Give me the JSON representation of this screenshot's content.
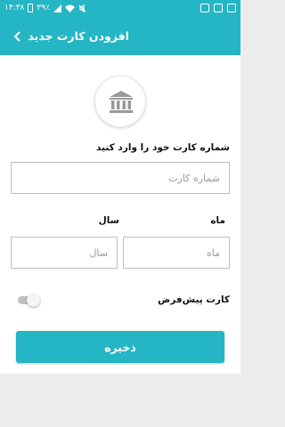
{
  "status_bar": {
    "time": "۱۴:۳۸",
    "battery": "۳۹٪",
    "icons": [
      "wifi-icon",
      "signal-icon",
      "mute-icon",
      "notification-icon",
      "gallery-icon"
    ]
  },
  "app_bar": {
    "title": "افزودن کارت جدید",
    "back_icon": "chevron-left-icon"
  },
  "bank_icon": "bank-icon",
  "card_form": {
    "instruction": "شماره کارت خود را وارد کنید",
    "card_number_placeholder": "شماره کارت",
    "card_number_value": "",
    "month_label": "ماه",
    "month_placeholder": "ماه",
    "month_value": "",
    "year_label": "سال",
    "year_placeholder": "سال",
    "year_value": "",
    "default_card_label": "کارت پیش‌فرض",
    "default_card_enabled": false,
    "save_label": "ذخیره"
  },
  "colors": {
    "primary": "#24b6c4",
    "background": "#ececec",
    "toggle_off": "#bfbfbf"
  }
}
